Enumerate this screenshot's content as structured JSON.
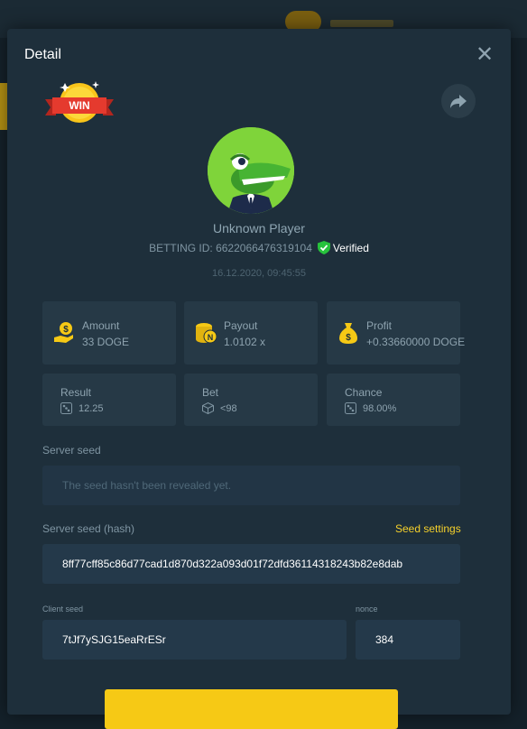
{
  "modal": {
    "title": "Detail",
    "close_icon": "close-icon",
    "share_icon": "share-icon"
  },
  "badge": {
    "text": "WIN"
  },
  "player": {
    "name": "Unknown Player",
    "betting_id_label": "BETTING ID: 6622066476319104",
    "verified_label": "Verified",
    "datetime": "16.12.2020, 09:45:55"
  },
  "stats": [
    {
      "label": "Amount",
      "value": "33 DOGE",
      "icon": "money-hand-icon"
    },
    {
      "label": "Payout",
      "value": "1.0102 x",
      "icon": "coins-icon"
    },
    {
      "label": "Profit",
      "value": "+0.33660000 DOGE",
      "icon": "money-bag-icon"
    }
  ],
  "results": [
    {
      "label": "Result",
      "value": "12.25",
      "icon": "dice-icon"
    },
    {
      "label": "Bet",
      "value": "<98",
      "icon": "cube-icon"
    },
    {
      "label": "Chance",
      "value": "98.00%",
      "icon": "dice-icon"
    }
  ],
  "server_seed": {
    "label": "Server seed",
    "placeholder": "The seed hasn't been revealed yet."
  },
  "server_seed_hash": {
    "label": "Server seed (hash)",
    "value": "8ff77cff85c86d77cad1d870d322a093d01f72dfd36114318243b82e8dab",
    "settings_label": "Seed settings"
  },
  "client_seed": {
    "label": "Client seed",
    "value": "7tJf7ySJG15eaRrESr"
  },
  "nonce": {
    "label": "nonce",
    "value": "384"
  },
  "colors": {
    "accent": "#f6c915",
    "verified": "#27c23c",
    "modal_bg": "#1e2f3b",
    "card_bg": "#263946"
  }
}
